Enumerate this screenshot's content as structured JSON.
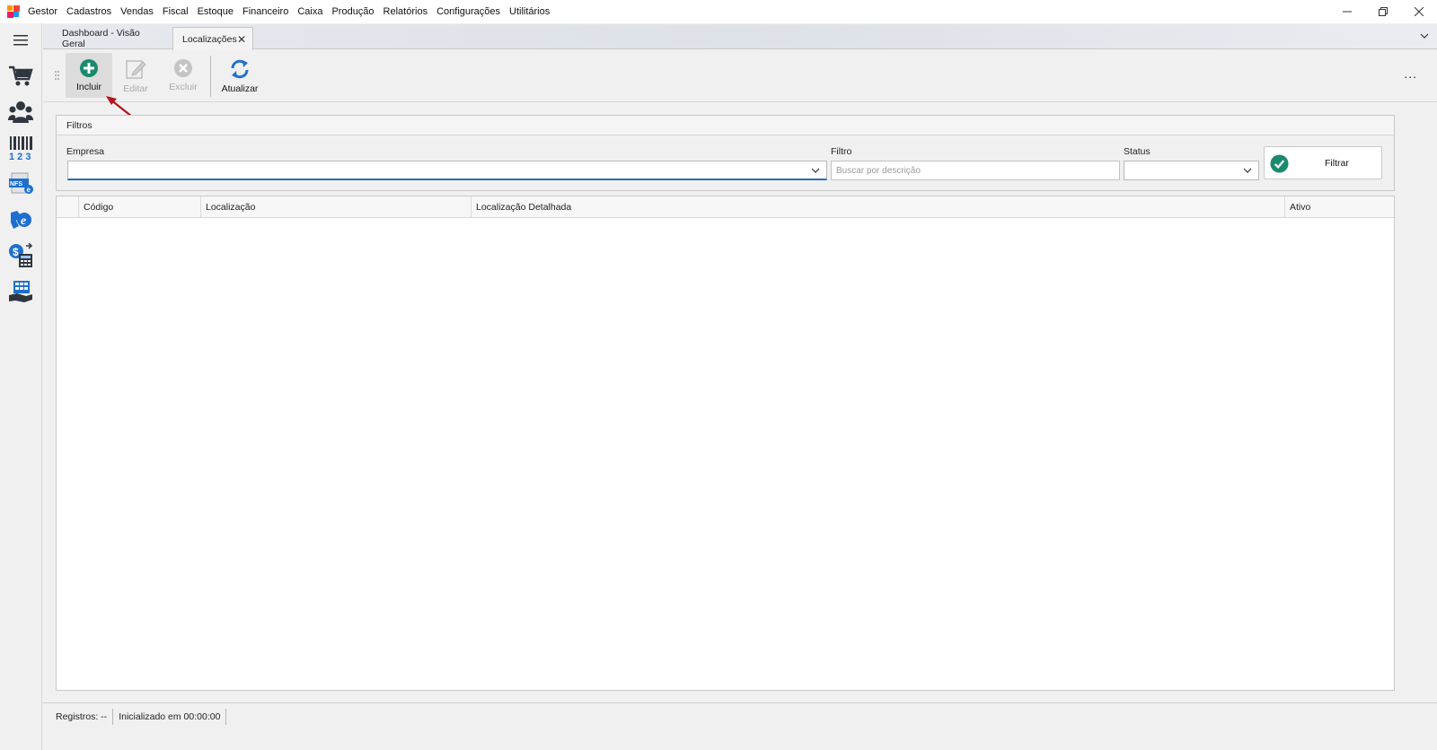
{
  "app": {
    "title": "Gestor"
  },
  "menu": [
    "Cadastros",
    "Vendas",
    "Fiscal",
    "Estoque",
    "Financeiro",
    "Caixa",
    "Produção",
    "Relatórios",
    "Configurações",
    "Utilitários"
  ],
  "tabs": [
    {
      "label": "Dashboard - Visão Geral",
      "active": false
    },
    {
      "label": "Localizações",
      "active": true
    }
  ],
  "sidebar": {
    "icons": [
      "hamburger-menu-icon",
      "shopping-cart-icon",
      "people-icon",
      "barcode-icon",
      "nfse-icon",
      "nfe-icon",
      "finance-calculator-icon",
      "cash-register-icon"
    ]
  },
  "toolbar": {
    "incluir": "Incluir",
    "editar": "Editar",
    "excluir": "Excluir",
    "atualizar": "Atualizar",
    "more": "..."
  },
  "filters": {
    "title": "Filtros",
    "empresa_label": "Empresa",
    "empresa_value": "",
    "filtro_label": "Filtro",
    "filtro_placeholder": "Buscar por descrição",
    "status_label": "Status",
    "status_value": "",
    "button": "Filtrar"
  },
  "grid": {
    "columns": [
      "Código",
      "Localização",
      "Localização Detalhada",
      "Ativo"
    ],
    "rows": []
  },
  "status": {
    "registros": "Registros: --",
    "inicializado": "Inicializado em 00:00:00"
  },
  "colors": {
    "accent_green": "#1a8a6e",
    "refresh_blue": "#1e6fd0",
    "annotation_red": "#b3141b"
  }
}
